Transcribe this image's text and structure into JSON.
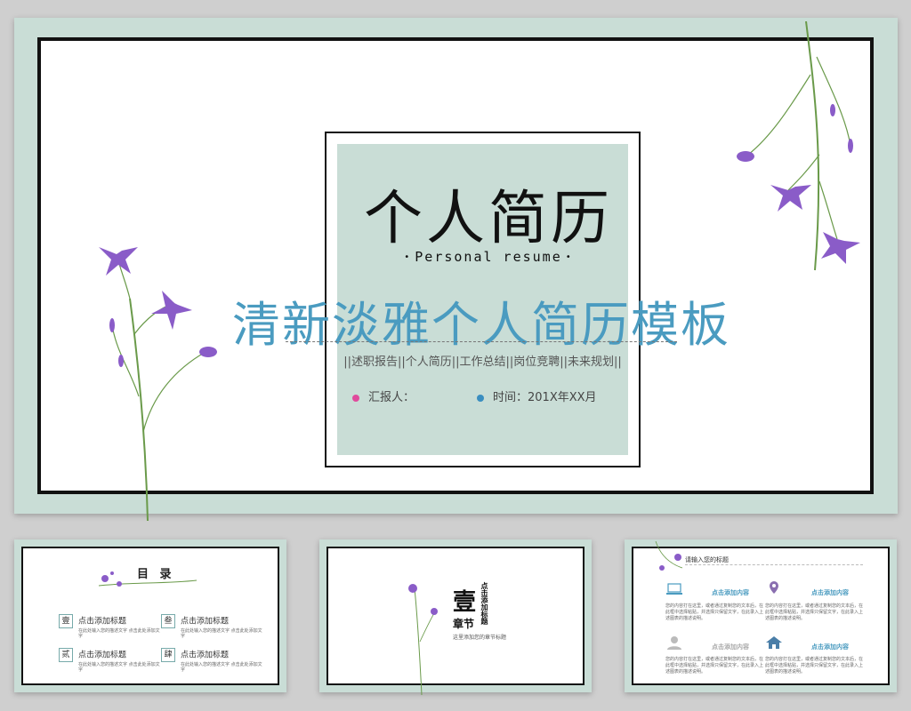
{
  "main": {
    "logo_cn": "个人简历",
    "logo_en": "Personal resume",
    "title": "清新淡雅个人简历模板",
    "subtitle": "||述职报告||个人简历||工作总结||岗位竞聘||未来规划||",
    "reporter": "汇报人：",
    "time": "时间：201X年XX月",
    "colors": {
      "accent": "#4a9bc0",
      "mint": "#c9ddd6",
      "pink_dot": "#e04a9c",
      "blue_dot": "#3a8ec0"
    }
  },
  "thumb1": {
    "title": "目 录",
    "items": [
      {
        "num": "壹",
        "label": "点击添加标题",
        "desc": "在此处输入您的描述文字 点击此处添加文字"
      },
      {
        "num": "叁",
        "label": "点击添加标题",
        "desc": "在此处输入您的描述文字 点击此处添加文字"
      },
      {
        "num": "贰",
        "label": "点击添加标题",
        "desc": "在此处输入您的描述文字 点击此处添加文字"
      },
      {
        "num": "肆",
        "label": "点击添加标题",
        "desc": "在此处输入您的描述文字 点击此处添加文字"
      }
    ]
  },
  "thumb2": {
    "number": "壹",
    "word": "章节",
    "vertical": "点击添加标题",
    "sub": "这里添加您的章节标题"
  },
  "thumb3": {
    "header": "请输入您的标题",
    "blocks": [
      {
        "label": "点击添加内容",
        "icon": "laptop-icon",
        "text": "您的内容打在这里，或者通过复制您的文本后，在此框中选择粘贴，并选择只保留文字，在此录入上述图表的描述说明。"
      },
      {
        "label": "点击添加内容",
        "icon": "location-pin-icon",
        "text": "您的内容打在这里，或者通过复制您的文本后，在此框中选择粘贴，并选择只保留文字，在此录入上述图表的描述说明。"
      },
      {
        "label": "点击添加内容",
        "icon": "user-icon",
        "text": "您的内容打在这里，或者通过复制您的文本后，在此框中选择粘贴，并选择只保留文字，在此录入上述图表的描述说明。"
      },
      {
        "label": "点击添加内容",
        "icon": "house-icon",
        "text": "您的内容打在这里，或者通过复制您的文本后，在此框中选择粘贴，并选择只保留文字，在此录入上述图表的描述说明。"
      }
    ]
  }
}
